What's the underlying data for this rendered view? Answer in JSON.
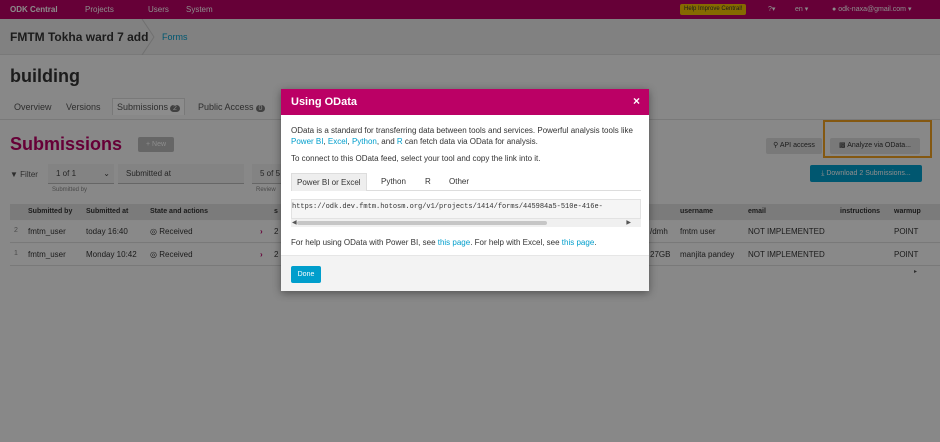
{
  "topnav": {
    "brand": "ODK Central",
    "links": [
      "Projects",
      "Users",
      "System"
    ],
    "help": "Help Improve Central!",
    "lang": "en",
    "user": "odk-naxa@gmail.com"
  },
  "header": {
    "project": "FMTM Tokha ward 7 add",
    "forms_link": "Forms"
  },
  "form": {
    "title": "building"
  },
  "tabs": [
    {
      "label": "Overview"
    },
    {
      "label": "Versions"
    },
    {
      "label": "Submissions",
      "badge": "2"
    },
    {
      "label": "Public Access",
      "badge": "0"
    }
  ],
  "submissions": {
    "title": "Submissions",
    "new_label": "New",
    "filter_label": "Filter",
    "submitted_by_value": "1 of 1",
    "submitted_by_caption": "Submitted by",
    "submitted_at_value": "Submitted at",
    "review_value": "5 of 5",
    "review_caption": "Review",
    "api_access": "API access",
    "analyze": "Analyze via OData...",
    "download": "Download 2 Submissions..."
  },
  "table": {
    "headers": [
      "Submitted by",
      "Submitted at",
      "State and actions",
      "s",
      "username",
      "email",
      "instructions",
      "warmup"
    ],
    "rows": [
      {
        "num": "2",
        "by": "fmtm_user",
        "at": "today 16:40",
        "state": "Received",
        "d": "2",
        "code": "/dmh",
        "username": "fmtm user",
        "email": "NOT IMPLEMENTED",
        "warmup": "POINT"
      },
      {
        "num": "1",
        "by": "fmtm_user",
        "at": "Monday 10:42",
        "state": "Received",
        "d": "2",
        "code": "27GB",
        "username": "manjita pandey",
        "email": "NOT IMPLEMENTED",
        "warmup": "POINT"
      }
    ]
  },
  "modal": {
    "title": "Using OData",
    "close": "×",
    "intro_1": "OData is a standard for transferring data between tools and services. Powerful analysis tools like ",
    "link_powerbi": "Power BI",
    "comma": ", ",
    "link_excel": "Excel",
    "link_python": "Python",
    "and": ", and ",
    "link_r": "R",
    "intro_2": " can fetch data via OData for analysis.",
    "connect": "To connect to this OData feed, select your tool and copy the link into it.",
    "tool_tabs": [
      "Power BI or Excel",
      "Python",
      "R",
      "Other"
    ],
    "url": "https://odk.dev.fmtm.hotosm.org/v1/projects/1414/forms/445984a5-510e-416e-",
    "help_1": "For help using OData with Power BI, see ",
    "help_link_1": "this page",
    "help_2": ". For help with Excel, see ",
    "help_link_2": "this page",
    "help_3": ".",
    "done": "Done"
  }
}
